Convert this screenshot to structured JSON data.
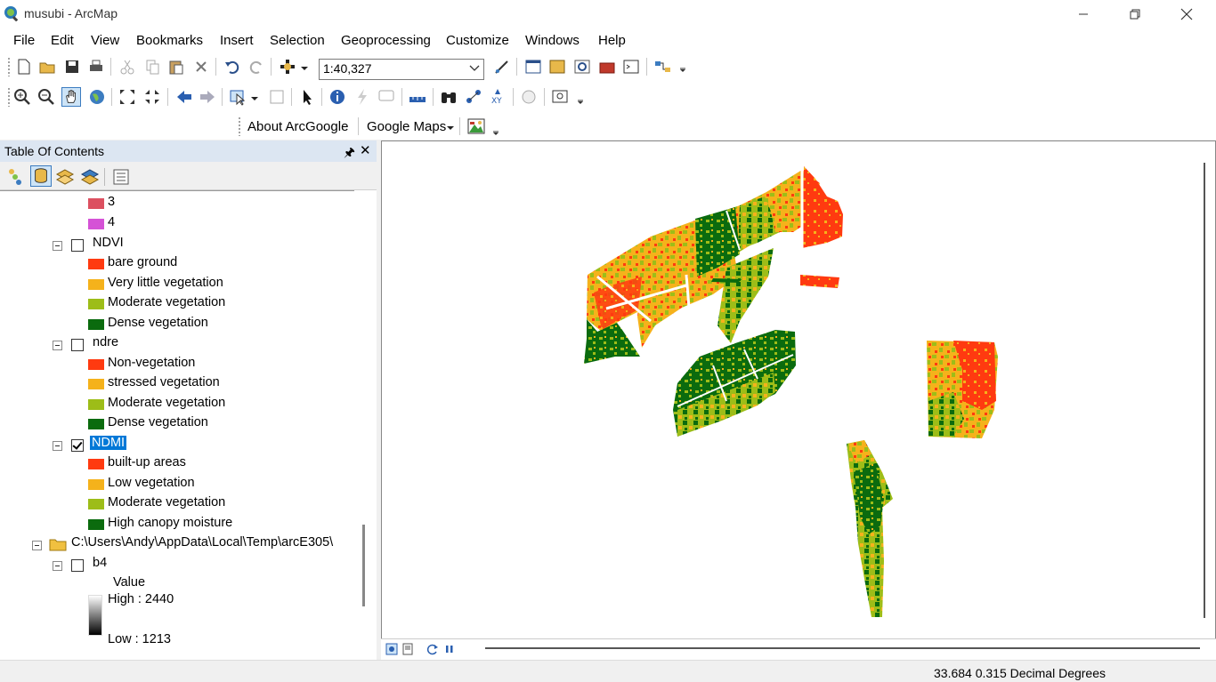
{
  "window": {
    "title": "musubi - ArcMap"
  },
  "menu": [
    "File",
    "Edit",
    "View",
    "Bookmarks",
    "Insert",
    "Selection",
    "Geoprocessing",
    "Customize",
    "Windows",
    "Help"
  ],
  "standard_toolbar": {
    "scale": "1:40,327"
  },
  "arcgoogle_toolbar": {
    "about_label": "About ArcGoogle",
    "maps_label": "Google Maps"
  },
  "toc": {
    "title": "Table Of Contents",
    "items": [
      {
        "kind": "class",
        "label": "3",
        "color": "#dc5060"
      },
      {
        "kind": "class",
        "label": "4",
        "color": "#d552d6"
      },
      {
        "kind": "layer",
        "label": "NDVI",
        "checked": false
      },
      {
        "kind": "class",
        "label": "bare ground",
        "color": "#ff3a10"
      },
      {
        "kind": "class",
        "label": "Very little vegetation",
        "color": "#f5b21b"
      },
      {
        "kind": "class",
        "label": "Moderate vegetation",
        "color": "#9dbd18"
      },
      {
        "kind": "class",
        "label": "Dense vegetation",
        "color": "#0b6b0e"
      },
      {
        "kind": "layer",
        "label": "ndre",
        "checked": false
      },
      {
        "kind": "class",
        "label": "Non-vegetation",
        "color": "#ff3a10"
      },
      {
        "kind": "class",
        "label": "stressed vegetation",
        "color": "#f5b21b"
      },
      {
        "kind": "class",
        "label": "Moderate vegetation",
        "color": "#9dbd18"
      },
      {
        "kind": "class",
        "label": "Dense vegetation",
        "color": "#0b6b0e"
      },
      {
        "kind": "layer",
        "label": "NDMI",
        "checked": true,
        "selected": true
      },
      {
        "kind": "class",
        "label": "built-up areas",
        "color": "#ff3a10"
      },
      {
        "kind": "class",
        "label": "Low vegetation",
        "color": "#f5b21b"
      },
      {
        "kind": "class",
        "label": "Moderate vegetation",
        "color": "#9dbd18"
      },
      {
        "kind": "class",
        "label": "High canopy moisture",
        "color": "#0b6b0e"
      },
      {
        "kind": "folder",
        "label": "C:\\Users\\Andy\\AppData\\Local\\Temp\\arcE305\\"
      },
      {
        "kind": "layer",
        "label": "b4",
        "checked": false
      }
    ],
    "stretch": {
      "title": "Value",
      "high": "High : 2440",
      "low": "Low : 1213"
    }
  },
  "status": {
    "coordinates": "33.684  0.315 Decimal Degrees"
  },
  "colors": {
    "red": "#ff3a10",
    "orange": "#f5b21b",
    "lightgreen": "#9dbd18",
    "darkgreen": "#0b6b0e",
    "toc_header": "#dce6f2",
    "selection": "#0078d7"
  }
}
